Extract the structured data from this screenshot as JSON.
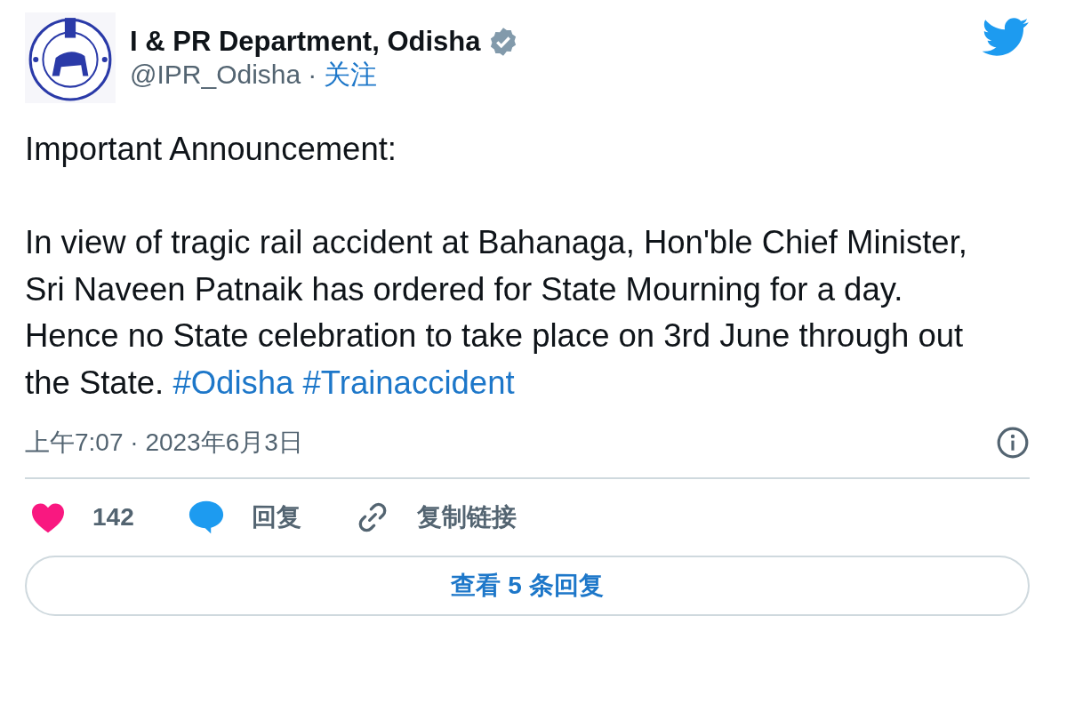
{
  "author": {
    "name": "I & PR Department, Odisha",
    "verified": true,
    "handle": "@IPR_Odisha",
    "separator": "·",
    "follow": "关注"
  },
  "paragraphs": [
    "Important Announcement:",
    "In view of tragic rail accident at Bahanaga, Hon'ble Chief Minister, Sri Naveen Patnaik has ordered for State Mourning for a day. Hence no State celebration to take place on 3rd June through out the State."
  ],
  "hashtags": [
    "#Odisha",
    "#Trainaccident"
  ],
  "timestamp": "上午7:07 · 2023年6月3日",
  "actions": [
    {
      "kind": "like",
      "label": "142"
    },
    {
      "kind": "reply",
      "label": "回复"
    },
    {
      "kind": "copy-link",
      "label": "复制链接"
    }
  ],
  "replies_button": "查看 5 条回复"
}
